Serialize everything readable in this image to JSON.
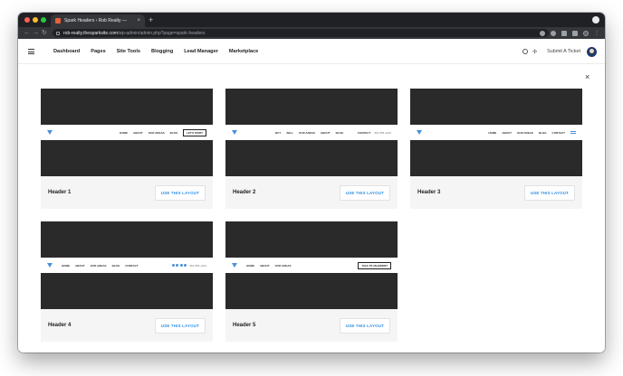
{
  "browser": {
    "tab_title": "Spark Headers ‹ Rob Realty — ",
    "tab_close": "×",
    "new_tab": "+",
    "url_host": "rob-realty.thesparksite.com",
    "url_path": "/wp-admin/admin.php?page=spark-headers",
    "back": "←",
    "forward": "→",
    "reload": "↻",
    "menu_dots": "⋮"
  },
  "wpnav": {
    "menu": [
      "Dashboard",
      "Pages",
      "Site Tools",
      "Blogging",
      "Lead Manager",
      "Marketplace"
    ],
    "submit_ticket": "Submit A Ticket",
    "tools_glyph": "✣"
  },
  "modal": {
    "close": "×"
  },
  "use_label": "USE THIS LAYOUT",
  "cards": [
    {
      "title": "Header 1",
      "menu": [
        "HOME",
        "ABOUT",
        "OUR AREAS",
        "BLOG"
      ],
      "cta": "LET'S START"
    },
    {
      "title": "Header 2",
      "left_menu": [
        "BUY",
        "SELL",
        "OUR AREAS",
        "ABOUT",
        "BLOG"
      ],
      "right_menu": [
        "CONTACT"
      ],
      "phone": "951-555-1234"
    },
    {
      "title": "Header 3",
      "menu": [
        "HOME",
        "ABOUT",
        "OUR AREAS",
        "BLOG",
        "CONTACT"
      ]
    },
    {
      "title": "Header 4",
      "menu": [
        "HOME",
        "ABOUT",
        "OUR AREAS",
        "BLOG",
        "CONTACT"
      ],
      "phone": "951-555-1234"
    },
    {
      "title": "Header 5",
      "menu": [
        "HOME",
        "ABOUT",
        "OUR AREAS"
      ],
      "cta": "TALK TO AN EXPERT"
    }
  ]
}
